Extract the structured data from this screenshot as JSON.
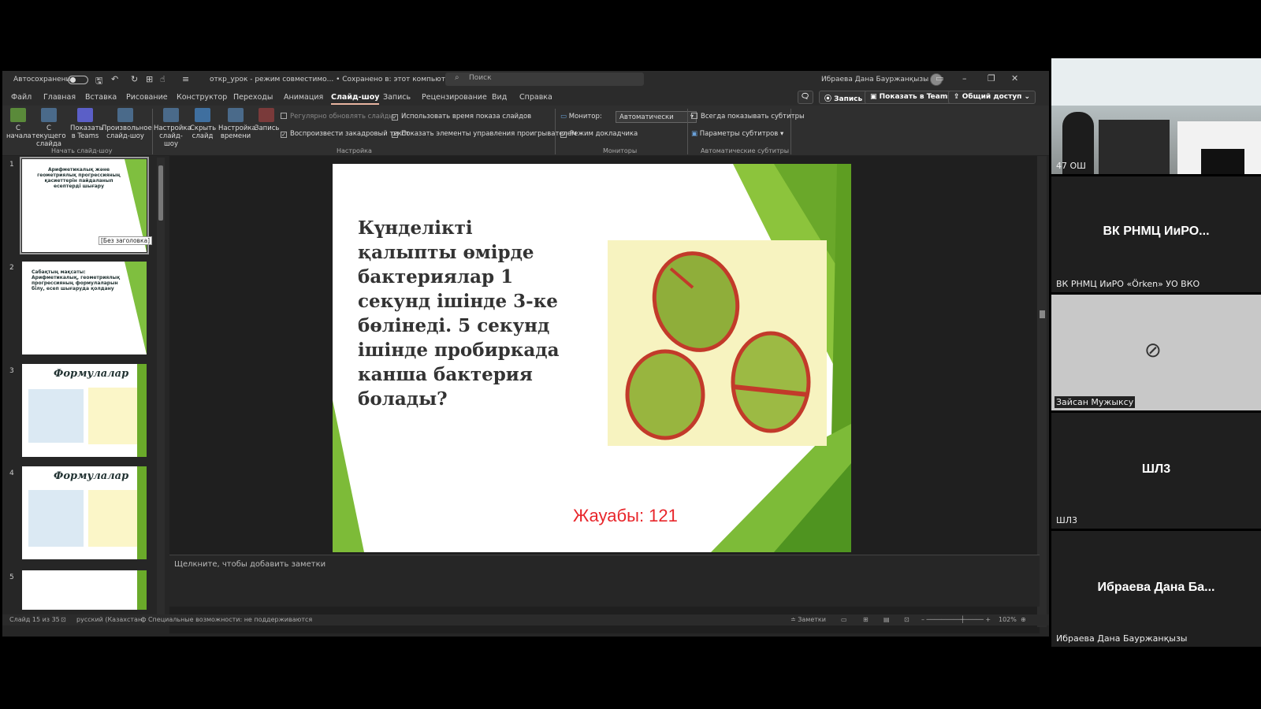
{
  "titlebar": {
    "autosave_label": "Автосохранение",
    "doc_title": "откр_урок - режим совместимо... • Сохранено в: этот компьютер ⌄",
    "search_placeholder": "Поиск",
    "user_name": "Ибраева Дана Бауржанқызы"
  },
  "menu": [
    "Файл",
    "Главная",
    "Вставка",
    "Рисование",
    "Конструктор",
    "Переходы",
    "Анимация",
    "Слайд-шоу",
    "Запись",
    "Рецензирование",
    "Вид",
    "Справка"
  ],
  "menu_active": "Слайд-шоу",
  "top_buttons": {
    "record": "Запись",
    "present_teams": "Показать в Teams",
    "share": "Общий доступ"
  },
  "ribbon": {
    "start": {
      "from_start": "С начала",
      "from_current": "С текущего слайда",
      "present_in_teams": "Показать в Teams",
      "custom": "Произвольное слайд-шоу",
      "group_label": "Начать слайд-шоу"
    },
    "setup": {
      "setup_show": "Настройка слайд-шоу",
      "hide_slide": "Скрыть слайд",
      "rehearse": "Настройка времени",
      "record": "Запись",
      "refresh": "Регулярно обновлять слайды",
      "narration": "Воспроизвести закадровый текст",
      "timings": "Использовать время показа слайдов",
      "media_controls": "Показать элементы управления проигрывателем",
      "group_label": "Настройка"
    },
    "monitors": {
      "monitor_label": "Монитор:",
      "monitor_value": "Автоматически",
      "presenter_view": "Режим докладчика",
      "group_label": "Мониторы"
    },
    "captions": {
      "always_show": "Всегда показывать субтитры",
      "settings": "Параметры субтитров",
      "group_label": "Автоматические субтитры"
    }
  },
  "thumbnails": [
    {
      "num": "1",
      "text": "Арифметикалық және геометриялық прогрессияның қасиеттерін пайдаланып есептерді шығару"
    },
    {
      "num": "2",
      "text": "Сабақтың мақсаты: Арифметикалық, геометриялық прогрессияның формулаларын білу, есеп шығаруда қолдану"
    },
    {
      "num": "3",
      "text": "Формулалар"
    },
    {
      "num": "4",
      "text": "Формулалар"
    },
    {
      "num": "5",
      "text": ""
    }
  ],
  "tooltip": "[Без заголовка]",
  "slide": {
    "question": "Күнделікті қалыпты өмірде бактериялар 1 секунд ішінде 3-ке бөлінеді. 5 секунд ішінде пробиркада канша бактерия болады?",
    "answer": "Жауабы: 121"
  },
  "notes_placeholder": "Щелкните, чтобы добавить заметки",
  "status": {
    "slide_count": "Слайд 15 из 35",
    "language": "русский (Казахстан)",
    "accessibility": "Специальные возможности: не поддерживаются",
    "notes": "Заметки",
    "zoom": "102%"
  },
  "participants": [
    {
      "label": "47 ОШ",
      "big": ""
    },
    {
      "label": "ВК РНМЦ ИиРО «Örken» УО ВКО",
      "big": "ВК РНМЦ ИиРО..."
    },
    {
      "label": "Зайсан Мужыксу",
      "big": ""
    },
    {
      "label": "ШЛ3",
      "big": "ШЛ3"
    },
    {
      "label": "Ибраева Дана Бауржанқызы",
      "big": "Ибраева Дана Ба..."
    }
  ]
}
